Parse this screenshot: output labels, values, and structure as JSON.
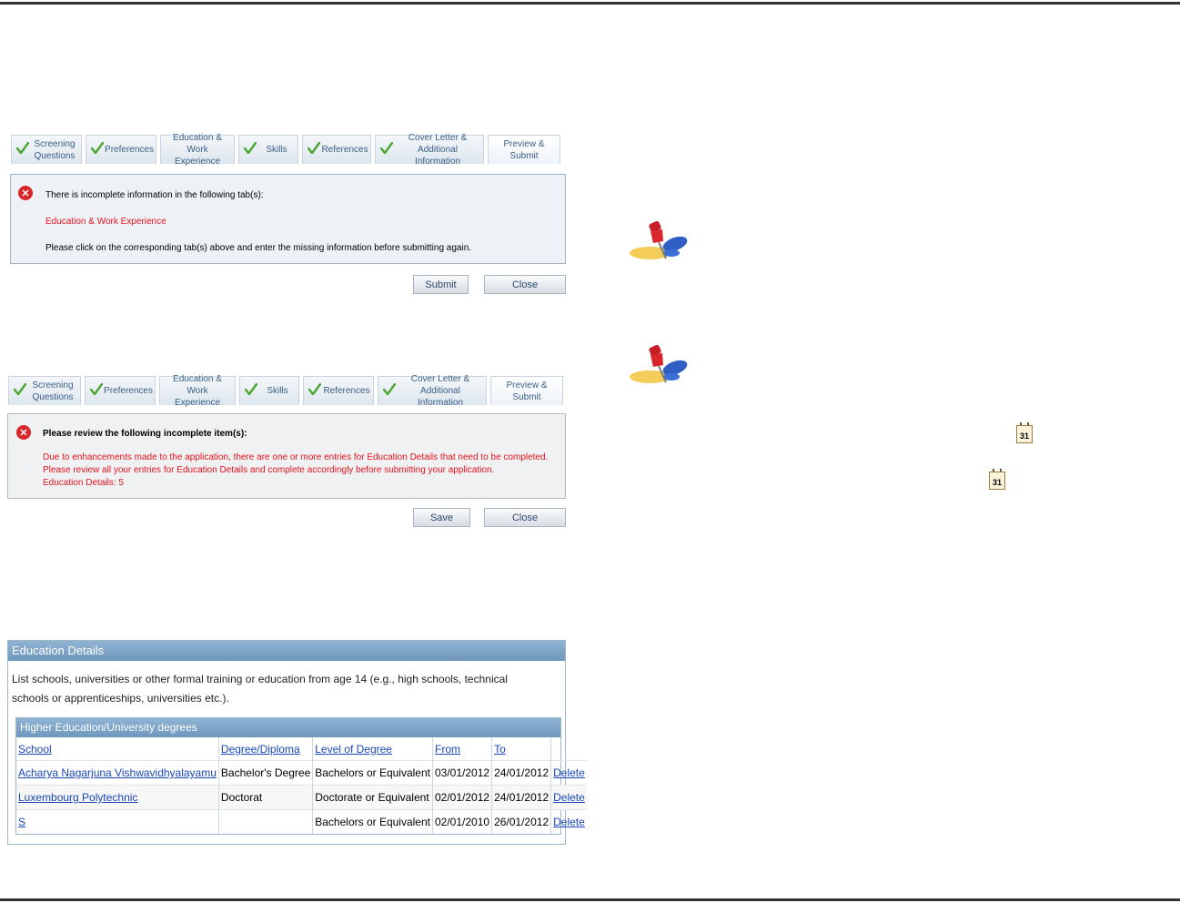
{
  "screenshot1": {
    "tabs": [
      {
        "label": "Screening\nQuestions",
        "checked": true
      },
      {
        "label": "Preferences",
        "checked": true
      },
      {
        "label": "Education &\nWork Experience",
        "checked": false
      },
      {
        "label": "Skills",
        "checked": true
      },
      {
        "label": "References",
        "checked": true
      },
      {
        "label": "Cover Letter &\nAdditional Information",
        "checked": true
      },
      {
        "label": "Preview &\nSubmit",
        "checked": false
      }
    ],
    "message_title": "There is incomplete information in the following tab(s):",
    "incomplete_tab": "Education & Work Experience",
    "instruction": "Please click on the corresponding tab(s) above and enter the missing information before submitting again.",
    "submit_label": "Submit",
    "close_label": "Close"
  },
  "screenshot2": {
    "tabs": [
      {
        "label": "Screening\nQuestions",
        "checked": true
      },
      {
        "label": "Preferences",
        "checked": true
      },
      {
        "label": "Education &\nWork Experience",
        "checked": false
      },
      {
        "label": "Skills",
        "checked": true
      },
      {
        "label": "References",
        "checked": true
      },
      {
        "label": "Cover Letter &\nAdditional Information",
        "checked": true
      },
      {
        "label": "Preview &\nSubmit",
        "checked": false
      }
    ],
    "message_title": "Please review the following incomplete item(s):",
    "detail": "Due to enhancements made to the application, there are one or more entries for Education Details that need to be completed. Please review all your entries for Education Details and complete accordingly before submitting your application.",
    "detail_count": "Education Details: 5",
    "save_label": "Save",
    "close_label": "Close"
  },
  "education": {
    "title": "Education Details",
    "description": "List schools, universities or other formal training or education from age 14 (e.g., high schools, technical schools or apprenticeships, universities etc.).",
    "subsection_title": "Higher Education/University degrees",
    "columns": [
      "School",
      "Degree/Diploma",
      "Level of Degree",
      "From",
      "To"
    ],
    "rows": [
      {
        "school": "Acharya Nagarjuna Vishwavidhyalayamu",
        "degree": "Bachelor's Degree",
        "level": "Bachelors or Equivalent",
        "from": "03/01/2012",
        "to": "24/01/2012",
        "action": "Delete"
      },
      {
        "school": "Luxembourg Polytechnic",
        "degree": "Doctorat",
        "level": "Doctorate or Equivalent",
        "from": "02/01/2012",
        "to": "24/01/2012",
        "action": "Delete"
      },
      {
        "school": "S",
        "degree": "",
        "level": "Bachelors or Equivalent",
        "from": "02/01/2010",
        "to": "26/01/2012",
        "action": "Delete"
      }
    ]
  },
  "calendar_icon_text": "31",
  "icons": [
    "pushpin-icon",
    "pushpin-icon",
    "calendar-icon",
    "calendar-icon",
    "checkmark-icon",
    "error-icon"
  ]
}
